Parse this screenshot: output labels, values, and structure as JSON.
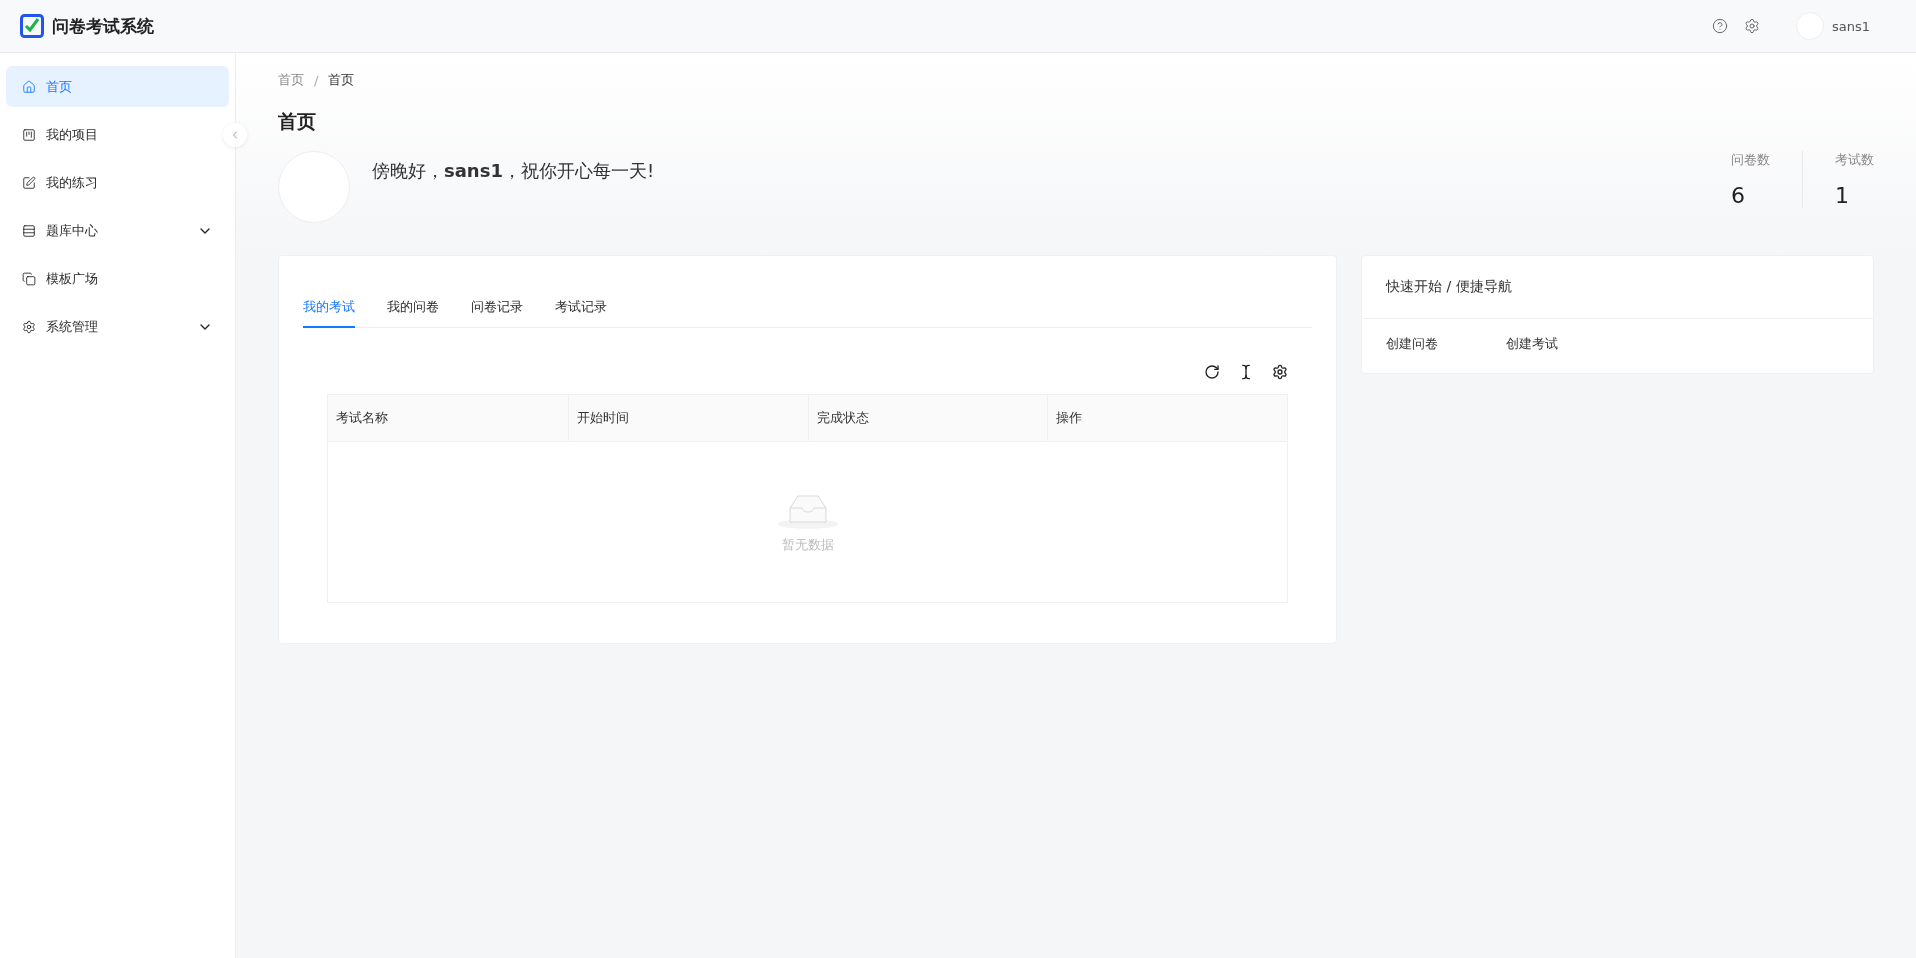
{
  "header": {
    "title": "问卷考试系统",
    "user": "sans1"
  },
  "sidebar": {
    "items": [
      {
        "label": "首页",
        "selected": true
      },
      {
        "label": "我的项目",
        "selected": false
      },
      {
        "label": "我的练习",
        "selected": false
      },
      {
        "label": "题库中心",
        "selected": false,
        "expanded": false
      },
      {
        "label": "模板广场",
        "selected": false
      },
      {
        "label": "系统管理",
        "selected": false,
        "expanded": false
      }
    ]
  },
  "breadcrumb": {
    "items": [
      "首页",
      "首页"
    ],
    "separator": "/"
  },
  "page_title": "首页",
  "greeting": "傍晚好，**sans1**，祝你开心每一天!",
  "stats": [
    {
      "label": "问卷数",
      "value": "6"
    },
    {
      "label": "考试数",
      "value": "1"
    }
  ],
  "tabs": [
    {
      "label": "我的考试",
      "selected": true
    },
    {
      "label": "我的问卷",
      "selected": false
    },
    {
      "label": "问卷记录",
      "selected": false
    },
    {
      "label": "考试记录",
      "selected": false
    }
  ],
  "table": {
    "columns": [
      "考试名称",
      "开始时间",
      "完成状态",
      "操作"
    ],
    "empty_text": "暂无数据"
  },
  "quick_start": {
    "title": "快速开始 / 便捷导航",
    "links": [
      "创建问卷",
      "创建考试"
    ]
  }
}
